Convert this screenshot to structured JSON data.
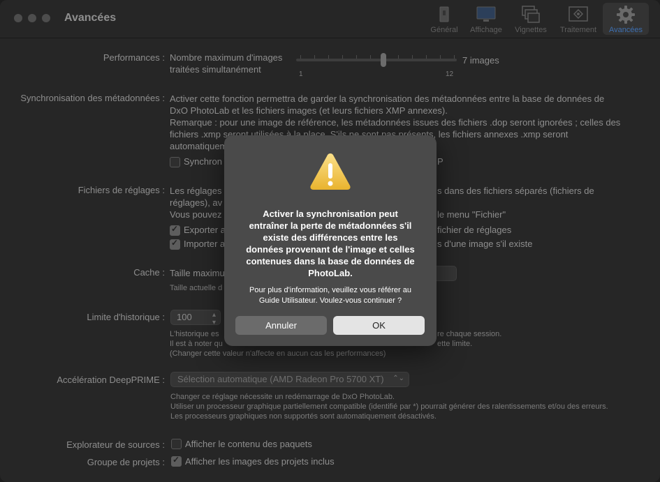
{
  "window": {
    "title": "Avancées"
  },
  "toolbar": {
    "items": [
      {
        "label": "Général",
        "icon": "general-icon"
      },
      {
        "label": "Affichage",
        "icon": "display-icon"
      },
      {
        "label": "Vignettes",
        "icon": "thumbnails-icon"
      },
      {
        "label": "Traitement",
        "icon": "processing-icon"
      },
      {
        "label": "Avancées",
        "icon": "gear-icon",
        "active": true
      }
    ]
  },
  "performances": {
    "label": "Performances :",
    "text_line1": "Nombre maximum d'images",
    "text_line2": "traitées simultanément",
    "slider_value": "7 images",
    "min_label": "1",
    "max_label": "12"
  },
  "sync": {
    "label": "Synchronisation des métadonnées :",
    "line1": "Activer cette fonction permettra de garder la synchronisation des métadonnées entre la base de données de",
    "line2": "DxO PhotoLab et les fichiers images (et leurs fichiers XMP annexes).",
    "line3": "Remarque : pour une image de référence, les métadonnées issues des fichiers .dop seront ignorées ; celles des",
    "line4": "fichiers .xmp seront utilisées à la place. S'ils ne sont pas présents, les fichiers annexes .xmp seront",
    "line5": "automatiquem",
    "checkbox_left": "Synchron",
    "checkbox_right": "P"
  },
  "settings_files": {
    "label": "Fichiers de réglages :",
    "line1_left": "Les réglages",
    "line1_right": "s dans des fichiers séparés (fichiers de",
    "line2": "réglages), av",
    "line3_left": "Vous pouvez",
    "line3_right": "le menu \"Fichier\"",
    "export_left": "Exporter a",
    "export_right": "fichier de réglages",
    "import_left": "Importer a",
    "import_right": "s d'une image s'il existe"
  },
  "cache": {
    "label": "Cache :",
    "text": "Taille maximu",
    "small": "Taille actuelle d"
  },
  "history": {
    "label": "Limite d'historique :",
    "value": "100",
    "line1_left": "L'historique es",
    "line1_right": "re chaque session.",
    "line2_left": "Il est à noter qu",
    "line2_right": "ette limite.",
    "line3": "(Changer cette valeur n'affecte en aucun cas les performances)"
  },
  "deepprime": {
    "label": "Accélération DeepPRIME :",
    "value": "Sélection automatique (AMD Radeon Pro 5700 XT)",
    "line1": "Changer ce réglage nécessite un redémarrage de DxO PhotoLab.",
    "line2": "Utiliser un processeur graphique partiellement compatible (identifié par *) pourrait générer des ralentissements et/ou des erreurs.",
    "line3": "Les processeurs graphiques non supportés sont automatiquement désactivés."
  },
  "sources": {
    "label": "Explorateur de sources :",
    "checkbox": "Afficher le contenu des paquets"
  },
  "projects": {
    "label": "Groupe de projets :",
    "checkbox": "Afficher les images des projets inclus"
  },
  "dialog": {
    "title_line1": "Activer la synchronisation peut",
    "title_line2": "entraîner la perte de métadonnées s'il",
    "title_line3": "existe des différences entre les",
    "title_line4": "données provenant de l'image et celles",
    "title_line5": "contenues dans la base de données de",
    "title_line6": "PhotoLab.",
    "body_line1": "Pour plus d'information, veuillez vous référer au",
    "body_line2": "Guide Utilisateur. Voulez-vous continuer ?",
    "cancel_label": "Annuler",
    "ok_label": "OK"
  },
  "colors": {
    "background": "#262626",
    "dialog": "#4a4a4a",
    "warning": "#f2c94c",
    "active_tab": "#3d6fb0"
  }
}
